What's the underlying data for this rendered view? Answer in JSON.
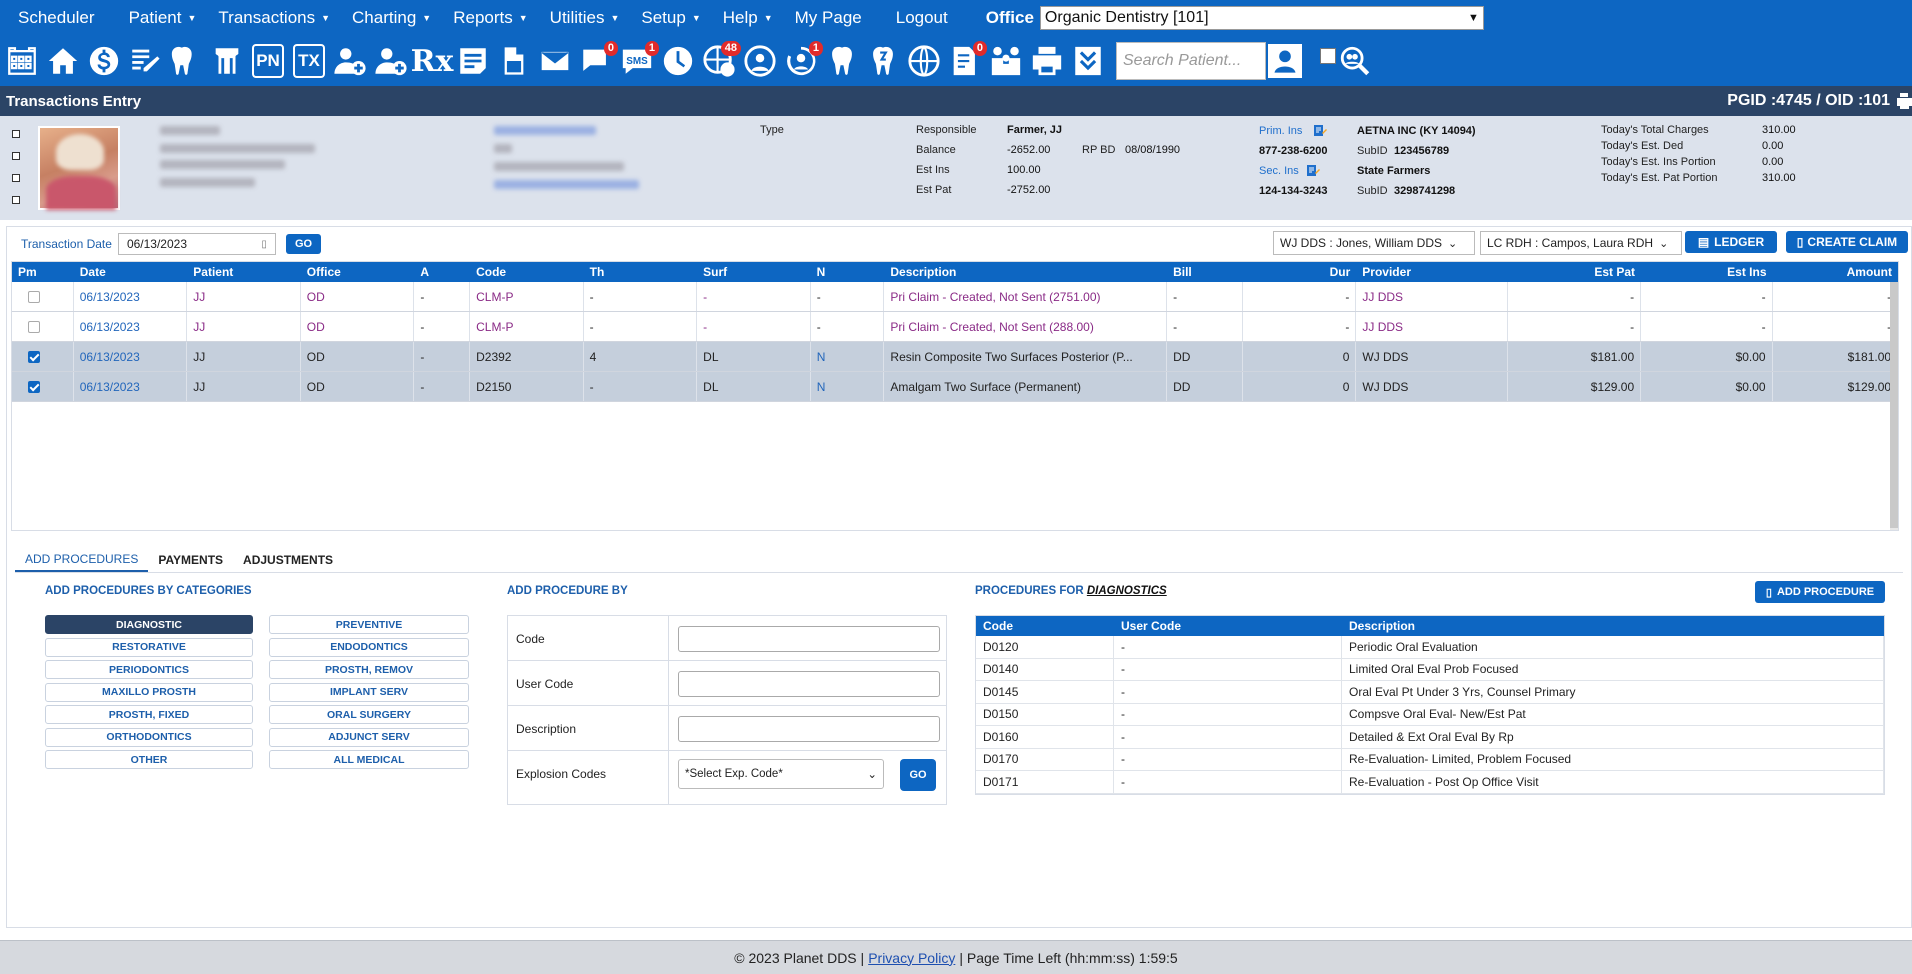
{
  "menu": {
    "items": [
      {
        "label": "Scheduler",
        "dropdown": false
      },
      {
        "label": "Patient",
        "dropdown": true
      },
      {
        "label": "Transactions",
        "dropdown": true
      },
      {
        "label": "Charting",
        "dropdown": true
      },
      {
        "label": "Reports",
        "dropdown": true
      },
      {
        "label": "Utilities",
        "dropdown": true
      },
      {
        "label": "Setup",
        "dropdown": true
      },
      {
        "label": "Help",
        "dropdown": true
      },
      {
        "label": "My Page",
        "dropdown": false
      },
      {
        "label": "Logout",
        "dropdown": false
      }
    ],
    "caret": "▼",
    "office_label": "Office",
    "office_value": "Organic Dentistry [101]"
  },
  "toolbar": {
    "pn": "PN",
    "tx": "TX",
    "rx": "Rx",
    "sms": "SMS",
    "badges": {
      "messages": "0",
      "sms": "1",
      "global": "48",
      "recall": "1",
      "forms": "0"
    },
    "search_placeholder": "Search Patient..."
  },
  "title": {
    "text": "Transactions Entry",
    "ids": "PGID :4745  /  OID :101"
  },
  "patient": {
    "type_label": "Type",
    "responsible_label": "Responsible",
    "responsible_value": "Farmer, JJ",
    "balance_label": "Balance",
    "balance_value": "-2652.00",
    "rpbd_label": "RP BD",
    "rpbd_value": "08/08/1990",
    "est_ins_label": "Est Ins",
    "est_ins_value": "100.00",
    "est_pat_label": "Est Pat",
    "est_pat_value": "-2752.00",
    "prim_ins_label": "Prim. Ins",
    "prim_ins_name": "AETNA INC (KY 14094)",
    "prim_phone": "877-238-6200",
    "prim_subid_label": "SubID",
    "prim_subid": "123456789",
    "sec_ins_label": "Sec. Ins",
    "sec_ins_name": "State Farmers",
    "sec_phone": "124-134-3243",
    "sec_subid_label": "SubID",
    "sec_subid": "3298741298",
    "totals": [
      {
        "label": "Today's Total Charges",
        "value": "310.00"
      },
      {
        "label": "Today's Est. Ded",
        "value": "0.00"
      },
      {
        "label": "Today's Est. Ins Portion",
        "value": "0.00"
      },
      {
        "label": "Today's Est. Pat Portion",
        "value": "310.00"
      }
    ]
  },
  "transactions": {
    "date_label": "Transaction Date",
    "date_value": "06/13/2023",
    "go_label": "GO",
    "provider_select": "WJ DDS : Jones, William DDS",
    "hygienist_select": "LC RDH : Campos, Laura RDH",
    "ledger_label": "LEDGER",
    "create_claim_label": "CREATE CLAIM",
    "columns": [
      "Pm",
      "Date",
      "Patient",
      "Office",
      "A",
      "Code",
      "Th",
      "Surf",
      "N",
      "Description",
      "Bill",
      "Dur",
      "Provider",
      "Est Pat",
      "Est Ins",
      "Amount"
    ],
    "rows": [
      {
        "checked": false,
        "selected": false,
        "purple": true,
        "date": "06/13/2023",
        "patient": "JJ",
        "office": "OD",
        "a": "-",
        "code": "CLM-P",
        "th": "-",
        "surf": "-",
        "n": "-",
        "description": "Pri Claim - Created, Not Sent (2751.00)",
        "bill": "-",
        "dur": "-",
        "provider": "JJ DDS",
        "est_pat": "-",
        "est_ins": "-",
        "amount": "-"
      },
      {
        "checked": false,
        "selected": false,
        "purple": true,
        "date": "06/13/2023",
        "patient": "JJ",
        "office": "OD",
        "a": "-",
        "code": "CLM-P",
        "th": "-",
        "surf": "-",
        "n": "-",
        "description": "Pri Claim - Created, Not Sent (288.00)",
        "bill": "-",
        "dur": "-",
        "provider": "JJ DDS",
        "est_pat": "-",
        "est_ins": "-",
        "amount": "-"
      },
      {
        "checked": true,
        "selected": true,
        "purple": false,
        "date": "06/13/2023",
        "patient": "JJ",
        "office": "OD",
        "a": "-",
        "code": "D2392",
        "th": "4",
        "surf": "DL",
        "n": "N",
        "description": "Resin Composite Two Surfaces Posterior (P...",
        "bill": "DD",
        "dur": "0",
        "provider": "WJ DDS",
        "est_pat": "$181.00",
        "est_ins": "$0.00",
        "amount": "$181.00"
      },
      {
        "checked": true,
        "selected": true,
        "purple": false,
        "date": "06/13/2023",
        "patient": "JJ",
        "office": "OD",
        "a": "-",
        "code": "D2150",
        "th": "-",
        "surf": "DL",
        "n": "N",
        "description": "Amalgam Two Surface (Permanent)",
        "bill": "DD",
        "dur": "0",
        "provider": "WJ DDS",
        "est_pat": "$129.00",
        "est_ins": "$0.00",
        "amount": "$129.00"
      }
    ]
  },
  "tabs": [
    "ADD PROCEDURES",
    "PAYMENTS",
    "ADJUSTMENTS"
  ],
  "categories": {
    "title": "ADD PROCEDURES BY CATEGORIES",
    "left": [
      "DIAGNOSTIC",
      "RESTORATIVE",
      "PERIODONTICS",
      "MAXILLO PROSTH",
      "PROSTH, FIXED",
      "ORTHODONTICS",
      "OTHER"
    ],
    "right": [
      "PREVENTIVE",
      "ENDODONTICS",
      "PROSTH, REMOV",
      "IMPLANT SERV",
      "ORAL SURGERY",
      "ADJUNCT SERV",
      "ALL MEDICAL"
    ]
  },
  "add_by": {
    "title": "ADD PROCEDURE BY",
    "code_label": "Code",
    "user_code_label": "User Code",
    "description_label": "Description",
    "explosion_label": "Explosion Codes",
    "explosion_select": "*Select Exp. Code*",
    "go_label": "GO"
  },
  "procedures": {
    "title_prefix": "PROCEDURES FOR ",
    "title_category": "DIAGNOSTICS",
    "add_button": "ADD PROCEDURE",
    "columns": [
      "Code",
      "User Code",
      "Description"
    ],
    "rows": [
      {
        "code": "D0120",
        "user_code": "-",
        "description": "Periodic Oral Evaluation"
      },
      {
        "code": "D0140",
        "user_code": "-",
        "description": "Limited Oral Eval Prob Focused"
      },
      {
        "code": "D0145",
        "user_code": "-",
        "description": "Oral Eval Pt Under 3 Yrs, Counsel Primary"
      },
      {
        "code": "D0150",
        "user_code": "-",
        "description": "Compsve Oral Eval- New/Est Pat"
      },
      {
        "code": "D0160",
        "user_code": "-",
        "description": "Detailed & Ext Oral Eval By Rp"
      },
      {
        "code": "D0170",
        "user_code": "-",
        "description": "Re-Evaluation- Limited, Problem Focused"
      },
      {
        "code": "D0171",
        "user_code": "-",
        "description": "Re-Evaluation - Post Op Office Visit"
      }
    ]
  },
  "footer": {
    "copyright": "© 2023 Planet DDS |",
    "privacy": "Privacy Policy",
    "time_left": "|  Page Time Left (hh:mm:ss) 1:59:5"
  },
  "colors": {
    "primary": "#0d66c2",
    "title_bar": "#2b4466",
    "header_bg": "#dce2ec",
    "claim_text": "#8a2a86",
    "badge": "#e12b2b"
  }
}
